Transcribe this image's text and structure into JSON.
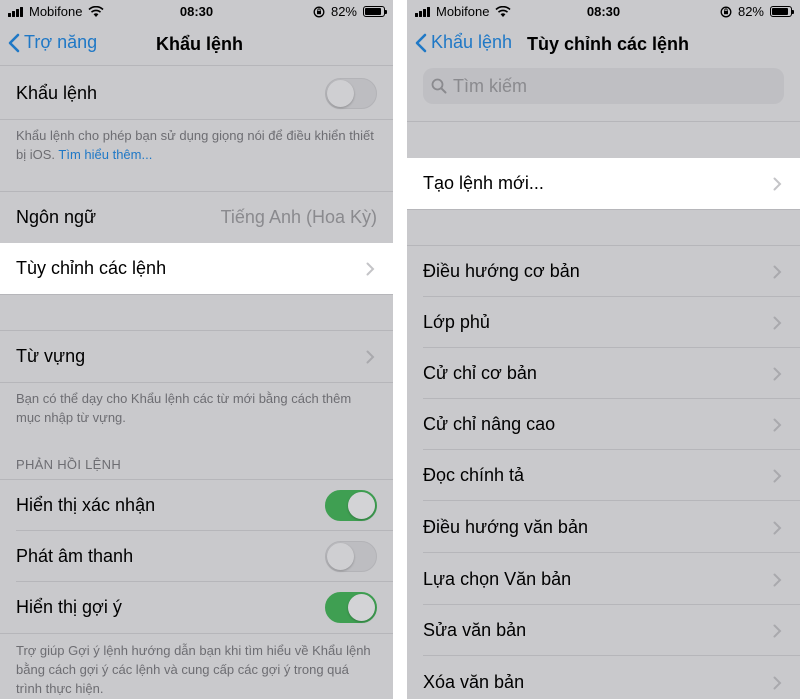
{
  "left": {
    "status": {
      "carrier": "Mobifone",
      "time": "08:30",
      "battery": "82%"
    },
    "nav": {
      "back_label": "Trợ năng",
      "title": "Khẩu lệnh"
    },
    "voice_control": {
      "label": "Khẩu lệnh",
      "toggle_on": false
    },
    "voice_control_footnote": "Khẩu lệnh cho phép bạn sử dụng giọng nói để điều khiển thiết bị iOS.",
    "learn_more": "Tìm hiểu thêm...",
    "language": {
      "label": "Ngôn ngữ",
      "value": "Tiếng Anh (Hoa Kỳ)"
    },
    "customize_commands": {
      "label": "Tùy chỉnh các lệnh"
    },
    "vocabulary": {
      "label": "Từ vựng"
    },
    "vocabulary_footnote": "Bạn có thể dạy cho Khẩu lệnh các từ mới bằng cách thêm mục nhập từ vựng.",
    "feedback_header": "PHẢN HỒI LỆNH",
    "show_confirmation": {
      "label": "Hiển thị xác nhận",
      "toggle_on": true
    },
    "play_sound": {
      "label": "Phát âm thanh",
      "toggle_on": false
    },
    "show_hints": {
      "label": "Hiển thị gợi ý",
      "toggle_on": true
    },
    "hints_footnote": "Trợ giúp Gợi ý lệnh hướng dẫn bạn khi tìm hiểu về Khẩu lệnh bằng cách gợi ý các lệnh và cung cấp các gợi ý trong quá trình thực hiện."
  },
  "right": {
    "status": {
      "carrier": "Mobifone",
      "time": "08:30",
      "battery": "82%"
    },
    "nav": {
      "back_label": "Khẩu lệnh",
      "title": "Tùy chỉnh các lệnh"
    },
    "search": {
      "placeholder": "Tìm kiếm"
    },
    "create_new": "Tạo lệnh mới...",
    "categories": [
      "Điều hướng cơ bản",
      "Lớp phủ",
      "Cử chỉ cơ bản",
      "Cử chỉ nâng cao",
      "Đọc chính tả",
      "Điều hướng văn bản",
      "Lựa chọn Văn bản",
      "Sửa văn bản",
      "Xóa văn bản"
    ]
  },
  "colors": {
    "accent": "#1f78c6",
    "toggle_on": "#3f9f52",
    "dimmed_background": "#c9c9cc",
    "highlight_row": "#ffffff"
  }
}
